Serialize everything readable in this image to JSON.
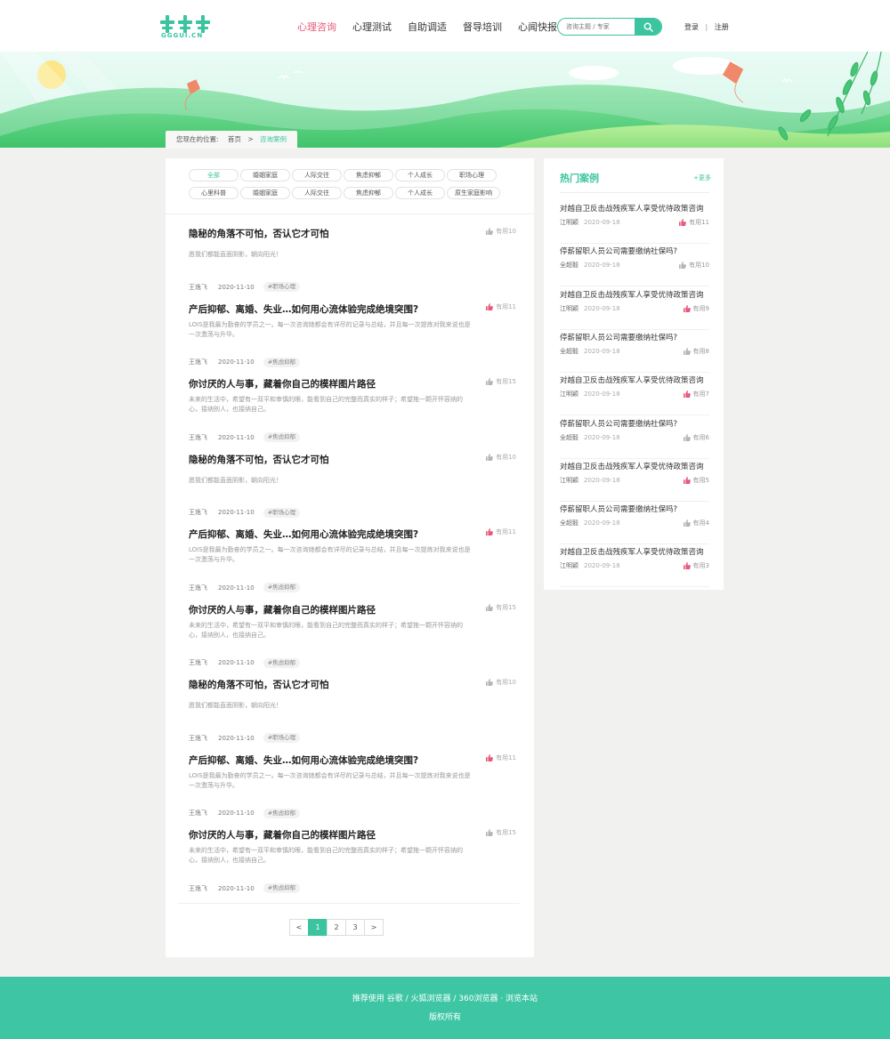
{
  "header": {
    "logo_text": "GGGUI.CN",
    "nav": [
      "心理咨询",
      "心理测试",
      "自助调适",
      "督导培训",
      "心闻快报"
    ],
    "nav_active": 0,
    "search_placeholder": "咨询主题 / 专家",
    "login": "登录",
    "separator": "|",
    "register": "注册"
  },
  "breadcrumb": {
    "prefix": "您现在的位置:",
    "home": "首页",
    "arrow": ">",
    "current": "咨询案例"
  },
  "filters": {
    "row1": [
      "全部",
      "婚姻家庭",
      "人际交往",
      "焦虑抑郁",
      "个人成长",
      "职场心理"
    ],
    "row2": [
      "心里科普",
      "婚姻家庭",
      "人际交往",
      "焦虑抑郁",
      "个人成长",
      "原生家庭影响"
    ],
    "active": "全部"
  },
  "articles": [
    {
      "title": "隐秘的角落不可怕，否认它才可怕",
      "desc": "愿我们都能直面阴影，朝向阳光！",
      "author": "王逸飞",
      "date": "2020-11-10",
      "tag": "#职场心理",
      "likes": "有用10",
      "hot": false
    },
    {
      "title": "产后抑郁、离婚、失业…如何用心流体验完成绝境突围?",
      "desc": "LOIS是我最为勤奋的学员之一。每一次咨询她都会有详尽的记录与总结，并且每一次提炼对我来说也是一次激荡与升华。",
      "author": "王逸飞",
      "date": "2020-11-10",
      "tag": "#焦虑抑郁",
      "likes": "有用11",
      "hot": true
    },
    {
      "title": "你讨厌的人与事，藏着你自己的模样图片路径",
      "desc": "未来的生活中，希望有一双平和审慎的眼，能看到自己的完整而真实的样子；希望拖一颗开怀容纳的心，接纳别人，也接纳自己。",
      "author": "王逸飞",
      "date": "2020-11-10",
      "tag": "#焦虑抑郁",
      "likes": "有用15",
      "hot": false
    },
    {
      "title": "隐秘的角落不可怕，否认它才可怕",
      "desc": "愿我们都能直面阴影，朝向阳光！",
      "author": "王逸飞",
      "date": "2020-11-10",
      "tag": "#职场心理",
      "likes": "有用10",
      "hot": false
    },
    {
      "title": "产后抑郁、离婚、失业…如何用心流体验完成绝境突围?",
      "desc": "LOIS是我最为勤奋的学员之一。每一次咨询她都会有详尽的记录与总结，并且每一次提炼对我来说也是一次激荡与升华。",
      "author": "王逸飞",
      "date": "2020-11-10",
      "tag": "#焦虑抑郁",
      "likes": "有用11",
      "hot": true
    },
    {
      "title": "你讨厌的人与事，藏着你自己的模样图片路径",
      "desc": "未来的生活中，希望有一双平和审慎的眼，能看到自己的完整而真实的样子；希望拖一颗开怀容纳的心，接纳别人，也接纳自己。",
      "author": "王逸飞",
      "date": "2020-11-10",
      "tag": "#焦虑抑郁",
      "likes": "有用15",
      "hot": false
    },
    {
      "title": "隐秘的角落不可怕，否认它才可怕",
      "desc": "愿我们都能直面阴影，朝向阳光！",
      "author": "王逸飞",
      "date": "2020-11-10",
      "tag": "#职场心理",
      "likes": "有用10",
      "hot": false
    },
    {
      "title": "产后抑郁、离婚、失业…如何用心流体验完成绝境突围?",
      "desc": "LOIS是我最为勤奋的学员之一。每一次咨询她都会有详尽的记录与总结，并且每一次提炼对我来说也是一次激荡与升华。",
      "author": "王逸飞",
      "date": "2020-11-10",
      "tag": "#焦虑抑郁",
      "likes": "有用11",
      "hot": true
    },
    {
      "title": "你讨厌的人与事，藏着你自己的模样图片路径",
      "desc": "未来的生活中，希望有一双平和审慎的眼，能看到自己的完整而真实的样子；希望拖一颗开怀容纳的心，接纳别人，也接纳自己。",
      "author": "王逸飞",
      "date": "2020-11-10",
      "tag": "#焦虑抑郁",
      "likes": "有用15",
      "hot": false
    }
  ],
  "pagination": {
    "prev": "<",
    "pages": [
      "1",
      "2",
      "3"
    ],
    "active": "1",
    "next": ">"
  },
  "sidebar": {
    "title": "热门案例",
    "more": "+更多",
    "items": [
      {
        "title": "对越自卫反击战残疾军人享受优待政策咨询",
        "author": "江明颖",
        "date": "2020-09-18",
        "likes": "有用11",
        "hot": true
      },
      {
        "title": "停薪留职人员公司需要缴纳社保吗?",
        "author": "全超毅",
        "date": "2020-09-18",
        "likes": "有用10",
        "hot": false
      },
      {
        "title": "对越自卫反击战残疾军人享受优待政策咨询",
        "author": "江明颖",
        "date": "2020-09-18",
        "likes": "有用9",
        "hot": true
      },
      {
        "title": "停薪留职人员公司需要缴纳社保吗?",
        "author": "全超毅",
        "date": "2020-09-18",
        "likes": "有用8",
        "hot": false
      },
      {
        "title": "对越自卫反击战残疾军人享受优待政策咨询",
        "author": "江明颖",
        "date": "2020-09-18",
        "likes": "有用7",
        "hot": true
      },
      {
        "title": "停薪留职人员公司需要缴纳社保吗?",
        "author": "全超毅",
        "date": "2020-09-18",
        "likes": "有用6",
        "hot": false
      },
      {
        "title": "对越自卫反击战残疾军人享受优待政策咨询",
        "author": "江明颖",
        "date": "2020-09-18",
        "likes": "有用5",
        "hot": true
      },
      {
        "title": "停薪留职人员公司需要缴纳社保吗?",
        "author": "全超毅",
        "date": "2020-09-18",
        "likes": "有用4",
        "hot": false
      },
      {
        "title": "对越自卫反击战残疾军人享受优待政策咨询",
        "author": "江明颖",
        "date": "2020-09-18",
        "likes": "有用3",
        "hot": true
      }
    ]
  },
  "footer": {
    "line1": "推荐使用 谷歌 / 火狐浏览器 / 360浏览器 · 浏览本站",
    "line2": "版权所有"
  },
  "colors": {
    "brand": "#3bc49f",
    "active_nav": "#e7587a",
    "hot_like": "#e7587a",
    "footer": "#3ec6a4"
  }
}
